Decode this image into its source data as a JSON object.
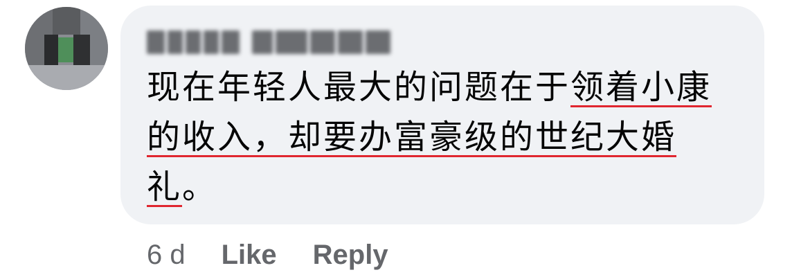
{
  "comment": {
    "author_name": "Jason Tan 陳 張 林",
    "text_segments": [
      {
        "text": "现在年轻人最大的问题在于",
        "flagged": false
      },
      {
        "text": "领着小康的收入，却要办富豪级的世纪大婚礼",
        "flagged": true
      },
      {
        "text": "。",
        "flagged": false
      }
    ],
    "timestamp": "6 d",
    "like_label": "Like",
    "reply_label": "Reply"
  },
  "colors": {
    "bubble_background": "#f0f2f5",
    "text": "#050505",
    "secondary_text": "#65676b",
    "spellcheck_underline": "#e0262f"
  }
}
